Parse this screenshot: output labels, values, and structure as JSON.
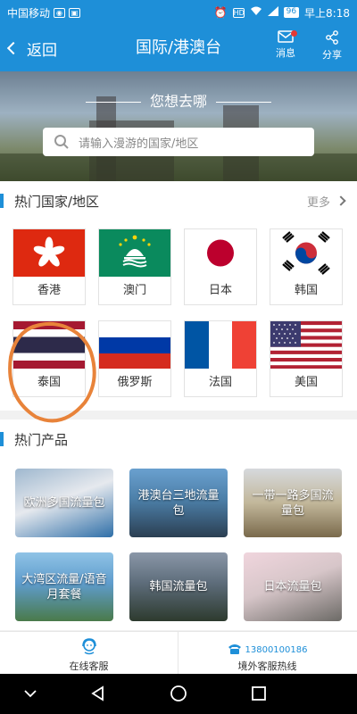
{
  "status_bar": {
    "carrier": "中国移动",
    "battery": "96",
    "time": "早上8:18"
  },
  "nav": {
    "back_label": "返回",
    "title": "国际/港澳台",
    "message_label": "消息",
    "share_label": "分享"
  },
  "hero": {
    "title": "您想去哪",
    "search_placeholder": "请输入漫游的国家/地区"
  },
  "hot_regions": {
    "title": "热门国家/地区",
    "more_label": "更多",
    "items": [
      {
        "name": "香港",
        "flag": "hong-kong"
      },
      {
        "name": "澳门",
        "flag": "macau"
      },
      {
        "name": "日本",
        "flag": "japan"
      },
      {
        "name": "韩国",
        "flag": "korea"
      },
      {
        "name": "泰国",
        "flag": "thailand"
      },
      {
        "name": "俄罗斯",
        "flag": "russia"
      },
      {
        "name": "法国",
        "flag": "france"
      },
      {
        "name": "美国",
        "flag": "usa"
      }
    ]
  },
  "hot_products": {
    "title": "热门产品",
    "items": [
      {
        "name": "欧洲多国流量包"
      },
      {
        "name": "港澳台三地流量包"
      },
      {
        "name": "一带一路多国流量包"
      },
      {
        "name": "大湾区流量/语音月套餐"
      },
      {
        "name": "韩国流量包"
      },
      {
        "name": "日本流量包"
      }
    ]
  },
  "service_bar": {
    "online_label": "在线客服",
    "hotline_number": "13800100186",
    "hotline_label": "境外客服热线"
  },
  "colors": {
    "primary": "#1e8fd8",
    "annotation": "#e8833a",
    "badge": "#e53935"
  }
}
